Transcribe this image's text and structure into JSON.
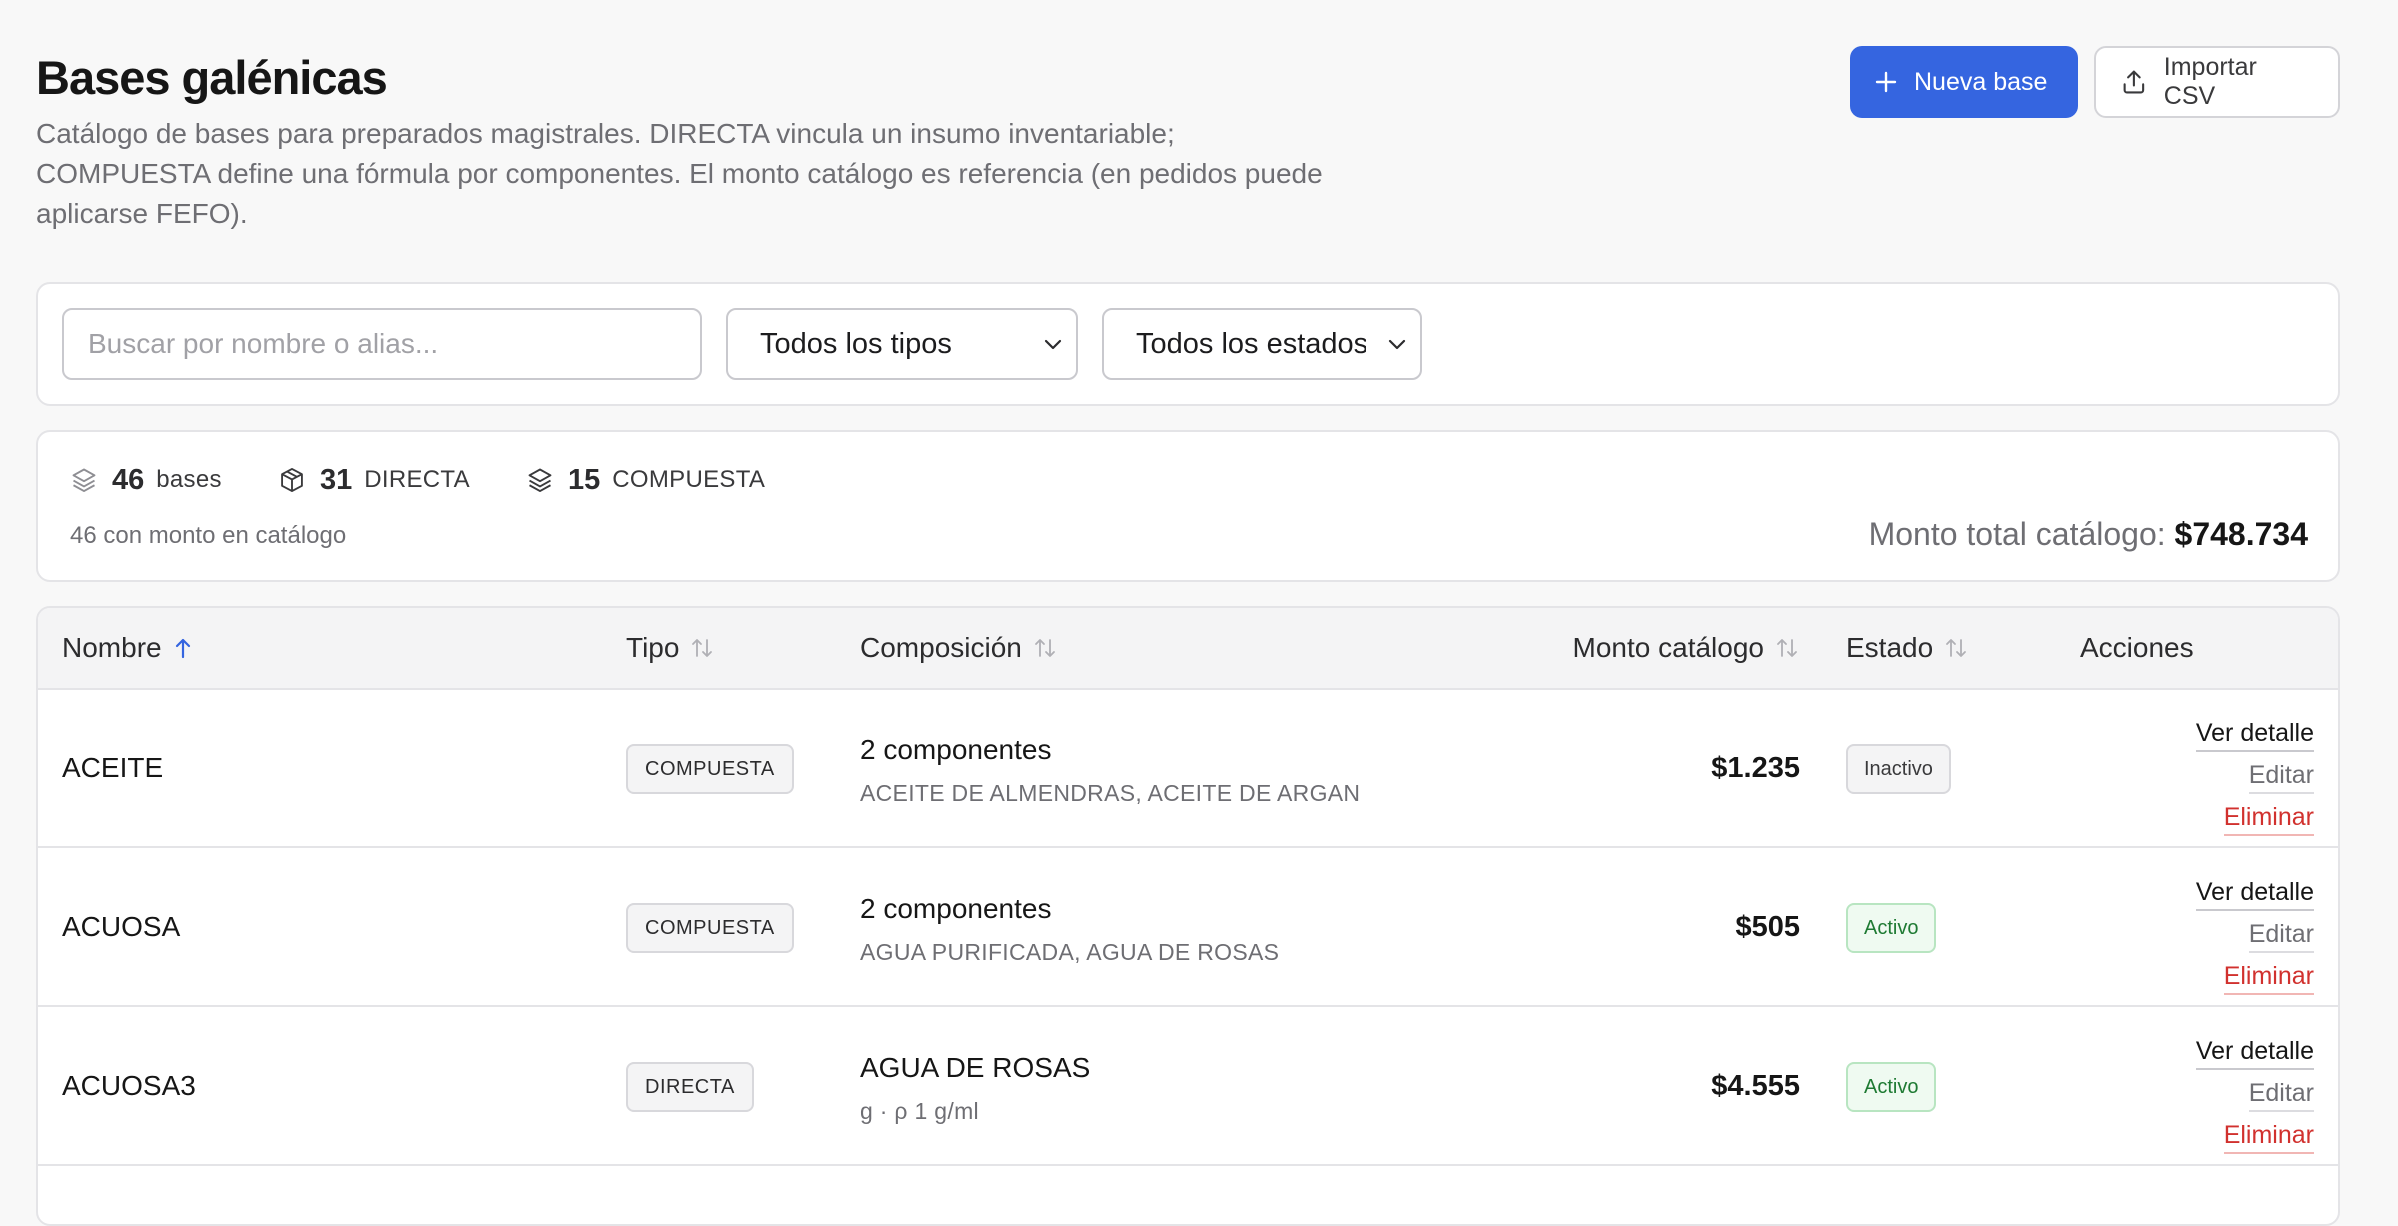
{
  "header": {
    "title": "Bases galénicas",
    "description": "Catálogo de bases para preparados magistrales. DIRECTA vincula un insumo inventariable; COMPUESTA define una fórmula por componentes. El monto catálogo es referencia (en pedidos puede aplicarse FEFO).",
    "new_button": "Nueva base",
    "import_button": "Importar CSV",
    "accent_color": "#3565e0"
  },
  "filters": {
    "search_placeholder": "Buscar por nombre o alias...",
    "tipo_selected": "Todos los tipos",
    "estado_selected": "Todos los estados"
  },
  "summary": {
    "total_count": "46",
    "total_label": "bases",
    "directa_count": "31",
    "directa_label": "DIRECTA",
    "compuesta_count": "15",
    "compuesta_label": "COMPUESTA",
    "with_amount": "46 con monto en catálogo",
    "monto_label": "Monto total catálogo:",
    "monto_value": "$748.734"
  },
  "table": {
    "columns": {
      "nombre": "Nombre",
      "tipo": "Tipo",
      "composicion": "Composición",
      "monto": "Monto catálogo",
      "estado": "Estado",
      "acciones": "Acciones"
    },
    "action_labels": {
      "view": "Ver detalle",
      "edit": "Editar",
      "delete": "Eliminar"
    },
    "rows": [
      {
        "nombre": "ACEITE",
        "tipo": "COMPUESTA",
        "comp_main": "2 componentes",
        "comp_sub": "ACEITE DE ALMENDRAS, ACEITE DE ARGAN",
        "monto": "$1.235",
        "estado": "Inactivo"
      },
      {
        "nombre": "ACUOSA",
        "tipo": "COMPUESTA",
        "comp_main": "2 componentes",
        "comp_sub": "AGUA PURIFICADA, AGUA DE ROSAS",
        "monto": "$505",
        "estado": "Activo"
      },
      {
        "nombre": "ACUOSA3",
        "tipo": "DIRECTA",
        "comp_main": "AGUA DE ROSAS",
        "comp_sub": "g · ρ 1 g/ml",
        "monto": "$4.555",
        "estado": "Activo"
      }
    ]
  }
}
